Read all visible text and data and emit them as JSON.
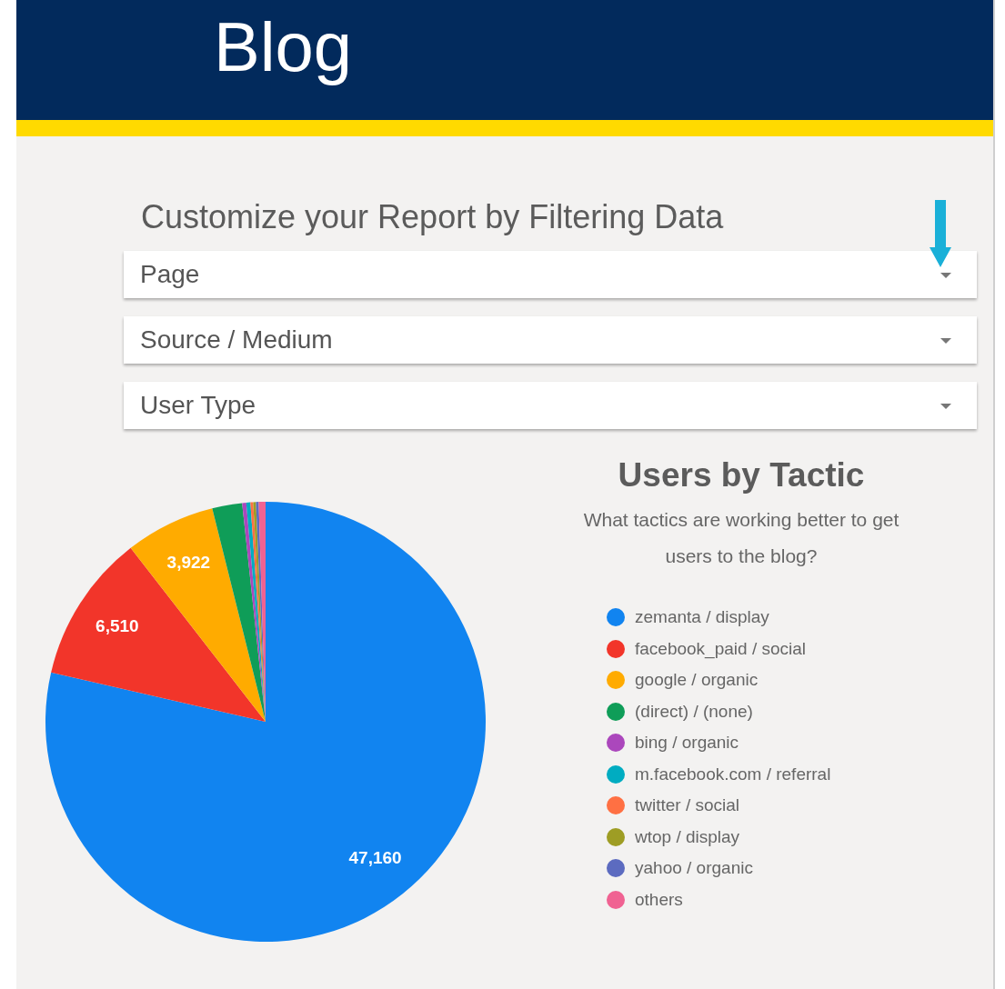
{
  "header": {
    "title": "Blog"
  },
  "filters": {
    "heading": "Customize your Report by Filtering Data",
    "dropdowns": [
      {
        "label": "Page",
        "highlighted": true
      },
      {
        "label": "Source / Medium",
        "highlighted": false
      },
      {
        "label": "User Type",
        "highlighted": false
      }
    ]
  },
  "chart_panel": {
    "title": "Users by Tactic",
    "subtitle": "What tactics are working better to get users to the blog?",
    "chart_data": {
      "type": "pie",
      "value_labels": [
        "47,160",
        "6,510",
        "3,922",
        null,
        null,
        null,
        null,
        null,
        null,
        null
      ],
      "categories": [
        "zemanta / display",
        "facebook_paid / social",
        "google / organic",
        "(direct) / (none)",
        "bing / organic",
        "m.facebook.com / referral",
        "twitter / social",
        "wtop / display",
        "yahoo / organic",
        "others"
      ],
      "series": [
        {
          "values": [
            78.6,
            10.9,
            6.6,
            2.2,
            0.3,
            0.3,
            0.2,
            0.2,
            0.2,
            0.5
          ]
        }
      ],
      "colors": [
        "#1184f0",
        "#f2352a",
        "#ffab00",
        "#0f9d58",
        "#ab47bc",
        "#00acc1",
        "#ff7043",
        "#9e9d24",
        "#5c6bc0",
        "#f06292"
      ]
    }
  }
}
